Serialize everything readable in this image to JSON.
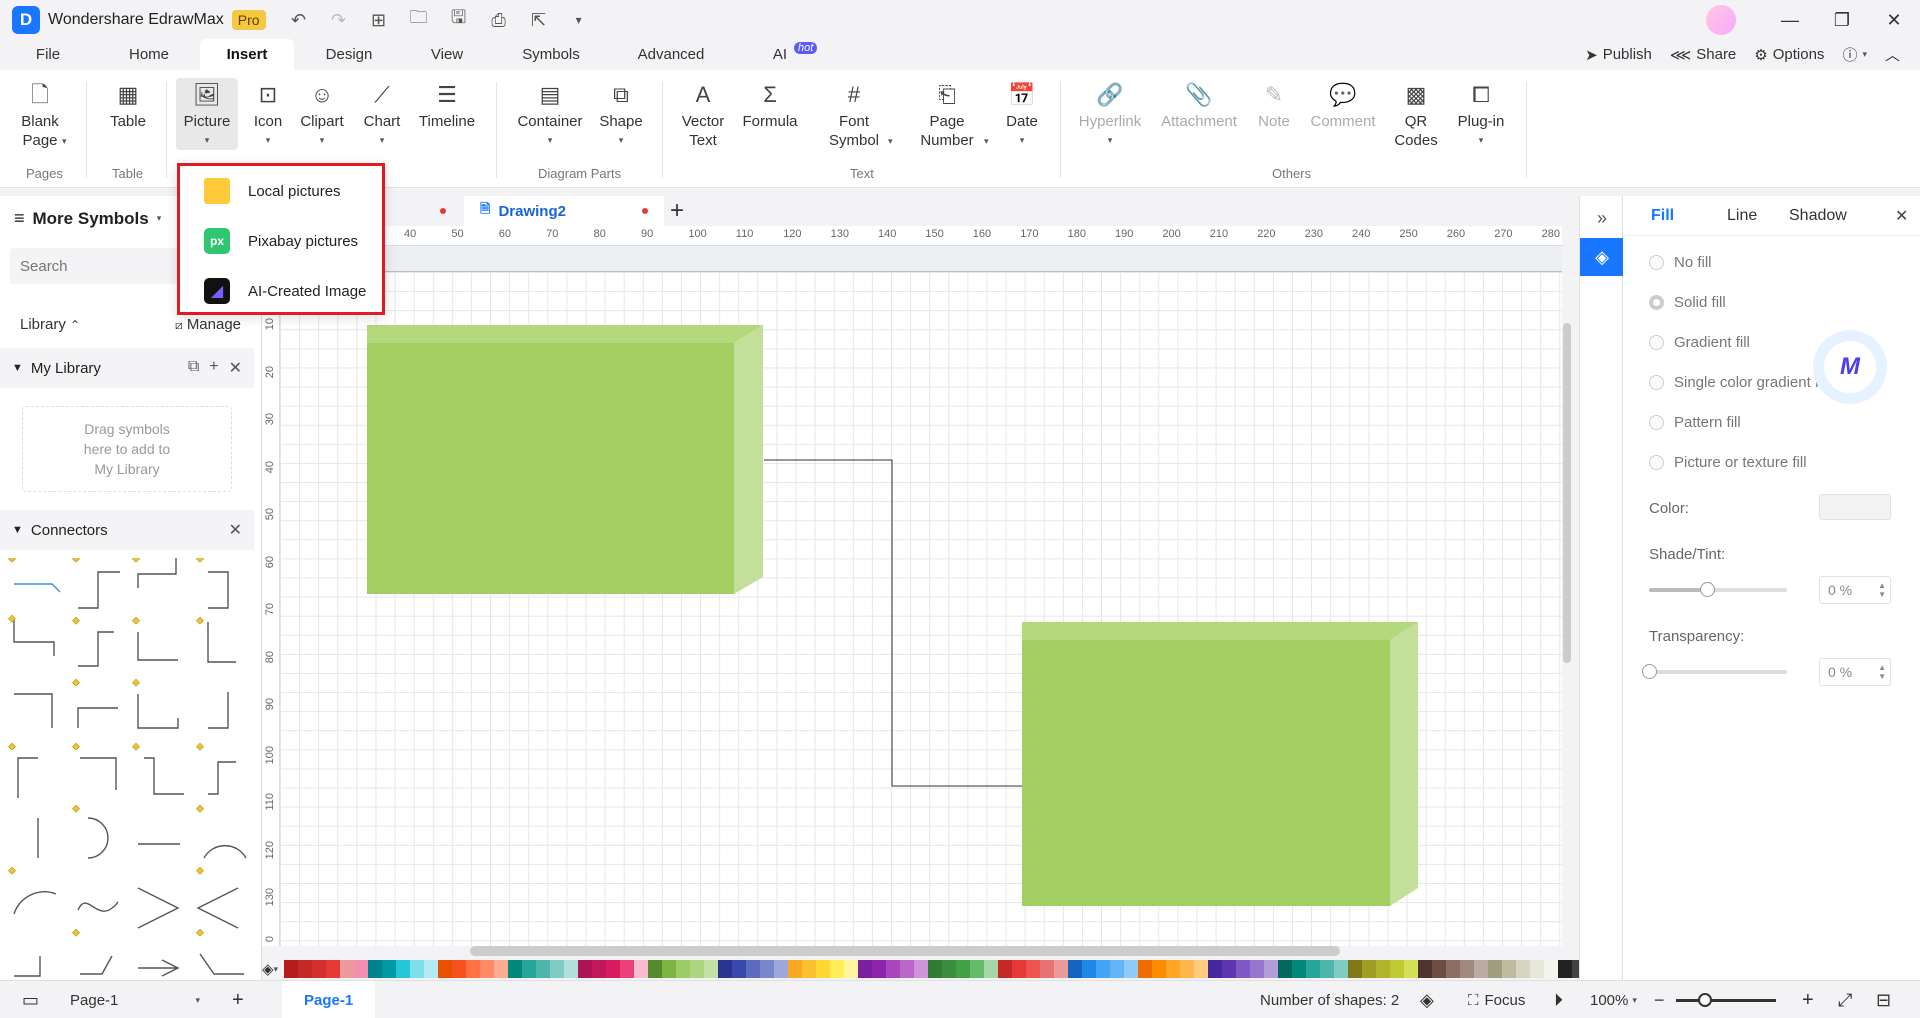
{
  "app": {
    "title": "Wondershare EdrawMax",
    "badge": "Pro"
  },
  "menu": {
    "tabs": [
      "File",
      "Home",
      "Insert",
      "Design",
      "View",
      "Symbols",
      "Advanced",
      "AI"
    ],
    "active": "Insert",
    "ai_badge": "hot",
    "actions": {
      "publish": "Publish",
      "share": "Share",
      "options": "Options"
    }
  },
  "ribbon": {
    "blank_page": "Blank\nPage",
    "table": "Table",
    "picture": "Picture",
    "icon": "Icon",
    "clipart": "Clipart",
    "chart": "Chart",
    "timeline": "Timeline",
    "container": "Container",
    "shape": "Shape",
    "vector_text": "Vector\nText",
    "formula": "Formula",
    "font_symbol": "Font\nSymbol",
    "page_number": "Page\nNumber",
    "date": "Date",
    "hyperlink": "Hyperlink",
    "attachment": "Attachment",
    "note": "Note",
    "comment": "Comment",
    "qr_codes": "QR\nCodes",
    "plugin": "Plug-in",
    "groups": {
      "pages": "Pages",
      "table": "Table",
      "diagram_parts": "Diagram Parts",
      "text": "Text",
      "others": "Others"
    }
  },
  "picture_menu": {
    "items": [
      {
        "label": "Local pictures",
        "icon": "folder-icon"
      },
      {
        "label": "Pixabay pictures",
        "icon": "pixabay-icon"
      },
      {
        "label": "AI-Created Image",
        "icon": "ai-image-icon"
      }
    ],
    "pixabay_glyph": "px"
  },
  "sidebar": {
    "title": "More Symbols",
    "search_placeholder": "Search",
    "library": "Library",
    "manage": "Manage",
    "my_library": "My Library",
    "drop_hint": "Drag symbols\nhere to add to\nMy Library",
    "connectors": "Connectors"
  },
  "doc_tabs": {
    "active": "Drawing2"
  },
  "rulers": {
    "h_ticks": [
      "40",
      "50",
      "60",
      "70",
      "80",
      "90",
      "100",
      "110",
      "120",
      "130",
      "140",
      "150",
      "160",
      "170",
      "180",
      "190",
      "200",
      "210",
      "220",
      "230",
      "240",
      "250",
      "260",
      "270",
      "280"
    ],
    "v_ticks": [
      "10",
      "20",
      "30",
      "40",
      "50",
      "60",
      "70",
      "80",
      "90",
      "100",
      "110",
      "120",
      "130",
      "0"
    ]
  },
  "colors": {
    "accent": "#1976ff",
    "shape_front": "#a3cf62",
    "shape_top": "#b3d97c",
    "shape_side": "#c3df9a",
    "highlight": "#e21b23",
    "palette": [
      "#b71c1c",
      "#c62828",
      "#d32f2f",
      "#e53935",
      "#ef9a9a",
      "#f48fb1",
      "#00838f",
      "#0097a7",
      "#26c6da",
      "#80deea",
      "#b2ebf2",
      "#e65100",
      "#f4511e",
      "#ff7043",
      "#ff8a65",
      "#ffab91",
      "#00897b",
      "#26a69a",
      "#4db6ac",
      "#80cbc4",
      "#b2dfdb",
      "#ad1457",
      "#c2185b",
      "#d81b60",
      "#ec407a",
      "#f8bbd0",
      "#558b2f",
      "#7cb342",
      "#9ccc65",
      "#aed581",
      "#c5e1a5",
      "#283593",
      "#3949ab",
      "#5c6bc0",
      "#7986cb",
      "#9fa8da",
      "#f9a825",
      "#fbc02d",
      "#fdd835",
      "#ffee58",
      "#fff59d",
      "#7b1fa2",
      "#8e24aa",
      "#ab47bc",
      "#ba68c8",
      "#ce93d8",
      "#2e7d32",
      "#388e3c",
      "#43a047",
      "#66bb6a",
      "#a5d6a7",
      "#c62828",
      "#e53935",
      "#ef5350",
      "#e57373",
      "#ef9a9a",
      "#1565c0",
      "#1e88e5",
      "#42a5f5",
      "#64b5f6",
      "#90caf9",
      "#ef6c00",
      "#fb8c00",
      "#ffa726",
      "#ffb74d",
      "#ffcc80",
      "#4527a0",
      "#5e35b1",
      "#7e57c2",
      "#9575cd",
      "#b39ddb",
      "#00695c",
      "#00897b",
      "#26a69a",
      "#4db6ac",
      "#80cbc4",
      "#827717",
      "#9e9d24",
      "#afb42b",
      "#c0ca33",
      "#d4e157",
      "#4e342e",
      "#6d4c41",
      "#8d6e63",
      "#a1887f",
      "#bcaaa4",
      "#9e9d80",
      "#bdbca0",
      "#d6d5c0",
      "#e8e7dc",
      "#f5f5ef",
      "#212121",
      "#424242",
      "#616161",
      "#757575",
      "#9e9e9e",
      "#bdbdbd",
      "#e0e0e0",
      "#eeeeee",
      "#f5f5f5",
      "#ffffff"
    ]
  },
  "fill_panel": {
    "tabs": [
      "Fill",
      "Line",
      "Shadow"
    ],
    "active_tab": "Fill",
    "options": [
      "No fill",
      "Solid fill",
      "Gradient fill",
      "Single color gradient fill",
      "Pattern fill",
      "Picture or texture fill"
    ],
    "selected_option": "Solid fill",
    "color_label": "Color:",
    "shade_label": "Shade/Tint:",
    "shade_value": "0 %",
    "shade_level": 0.42,
    "transparency_label": "Transparency:",
    "transparency_value": "0 %",
    "transparency_level": 0
  },
  "status": {
    "page_select": "Page-1",
    "page_tab": "Page-1",
    "shapes": "Number of shapes: 2",
    "focus": "Focus",
    "zoom": "100%"
  }
}
